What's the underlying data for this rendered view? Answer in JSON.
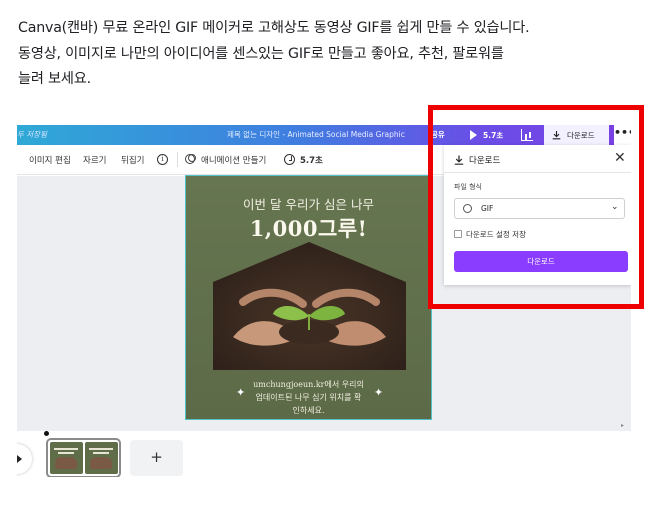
{
  "intro": {
    "line1": "Canva(캔바) 무료 온라인 GIF 메이커로 고해상도 동영상 GIF를 쉽게 만들 수 있습니다.",
    "line2": "동영상, 이미지로 나만의 아이디어를 센스있는 GIF로 만들고 좋아요, 추천, 팔로워를",
    "line3": "늘려 보세요."
  },
  "editor": {
    "topbar": {
      "status": "두 저장됨",
      "title": "제목 없는 디자인 - Animated Social Media Graphic",
      "share": "공유",
      "play_duration": "5.7초",
      "download": "다운로드",
      "more": "•••"
    },
    "toolbar": {
      "edit_image": "이미지 편집",
      "crop": "자르기",
      "flip": "뒤집기",
      "info": "i",
      "animate": "애니메이션 만들기",
      "duration": "5.7초"
    },
    "design": {
      "headline_small": "이번 달 우리가 심은 나무",
      "headline_big": "1,000그루!",
      "footer_line1": "umchungjoeun.kr에서 우리의",
      "footer_line2": "업데이트된 나무 심기 위치를 확",
      "footer_line3": "인하세요."
    },
    "download_panel": {
      "title": "다운로드",
      "close": "✕",
      "file_type_label": "파일 형식",
      "file_type_value": "GIF",
      "chevron": "⌄",
      "save_settings_label": "다운로드 설정 저장",
      "save_settings_checked": false,
      "download_button": "다운로드"
    },
    "timeline": {
      "add_page": "+"
    }
  },
  "colors": {
    "accent": "#8b3dff",
    "highlight_box": "#ee0000",
    "design_bg": "#5f6e49"
  }
}
